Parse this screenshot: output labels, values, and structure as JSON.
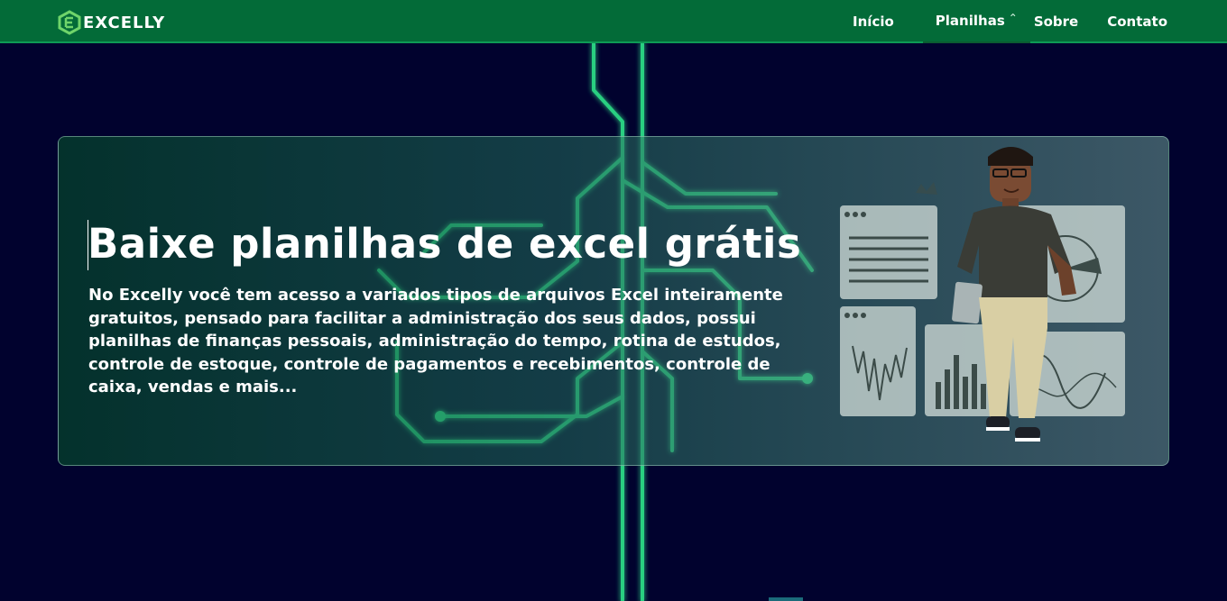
{
  "brand": {
    "name": "EXCELLY",
    "logo_icon": "hexagon-e-logo-icon"
  },
  "nav": {
    "items": [
      {
        "label": "Início"
      },
      {
        "label": "Planilhas",
        "icon": "chevron-up-icon"
      },
      {
        "label": "Sobre"
      },
      {
        "label": "Contato"
      }
    ]
  },
  "hero": {
    "title": "Baixe planilhas de excel grátis",
    "description": "No Excelly você tem acesso a variados tipos de arquivos Excel inteiramente gratuitos, pensado para facilitar a administração dos seus dados, possui planilhas de finanças pessoais, administração do tempo, rotina de estudos, controle de estoque, controle de pagamentos e recebimentos, controle de caixa, vendas e mais..."
  },
  "colors": {
    "navbar": "#036b38",
    "background": "#01022e",
    "circuit": "#2ee68a",
    "accent": "#6fd46a"
  }
}
